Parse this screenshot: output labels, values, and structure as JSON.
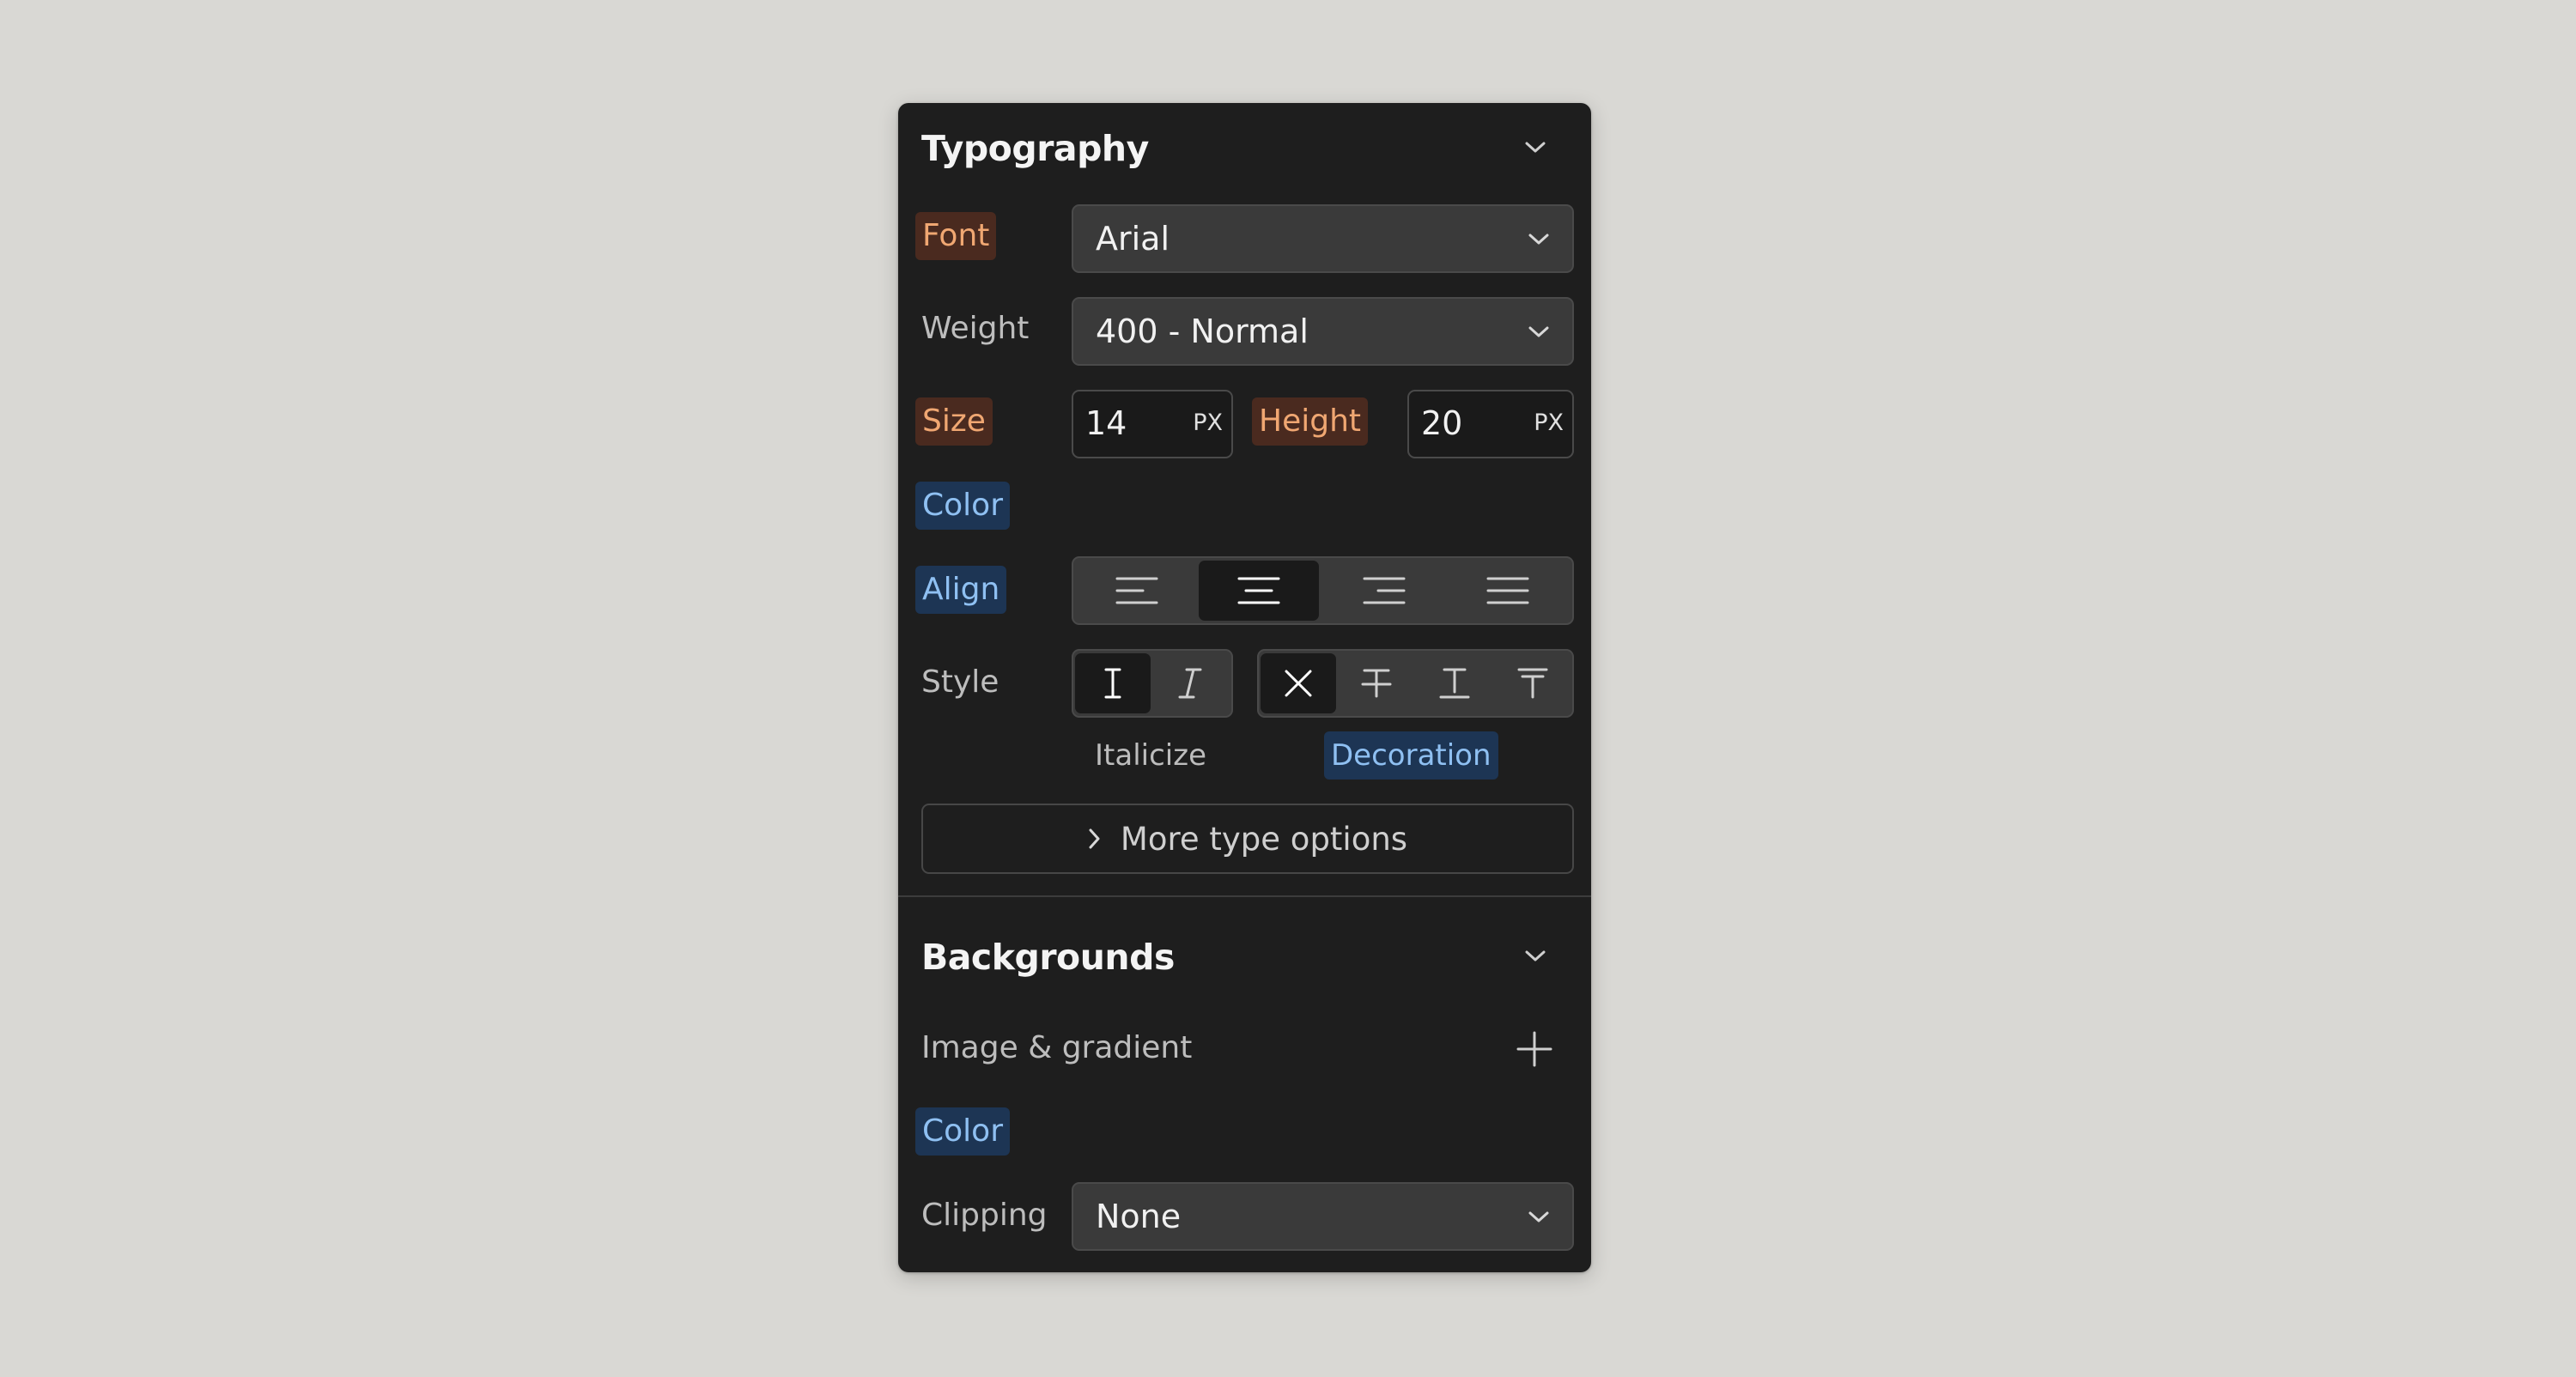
{
  "typography": {
    "title": "Typography",
    "font": {
      "label": "Font",
      "value": "Arial"
    },
    "weight": {
      "label": "Weight",
      "value": "400 - Normal"
    },
    "size": {
      "label": "Size",
      "value": "14",
      "unit": "PX"
    },
    "height": {
      "label": "Height",
      "value": "20",
      "unit": "PX"
    },
    "color": {
      "label": "Color"
    },
    "align": {
      "label": "Align",
      "options": [
        "left",
        "center",
        "right",
        "justify"
      ],
      "selected": "center"
    },
    "style": {
      "label": "Style",
      "italicize_label": "Italicize",
      "italicize_options": [
        "regular",
        "italic"
      ],
      "italicize_selected": "regular",
      "decoration_label": "Decoration",
      "decoration_options": [
        "none",
        "strikethrough",
        "underline",
        "overline"
      ],
      "decoration_selected": "none"
    },
    "more_options": "More type options"
  },
  "backgrounds": {
    "title": "Backgrounds",
    "image_gradient": {
      "label": "Image & gradient"
    },
    "color": {
      "label": "Color"
    },
    "clipping": {
      "label": "Clipping",
      "value": "None"
    }
  },
  "colors": {
    "background": "#d9d8d4",
    "panel": "#1e1e1e",
    "tag_orange_bg": "#4a2a1f",
    "tag_orange_text": "#f0a772",
    "tag_blue_bg": "#1d3554",
    "tag_blue_text": "#8fc0f2"
  },
  "icons": {
    "section_toggle": "chevron-down-icon",
    "dropdown": "chevron-down-icon",
    "more": "chevron-right-icon",
    "add": "plus-icon"
  }
}
